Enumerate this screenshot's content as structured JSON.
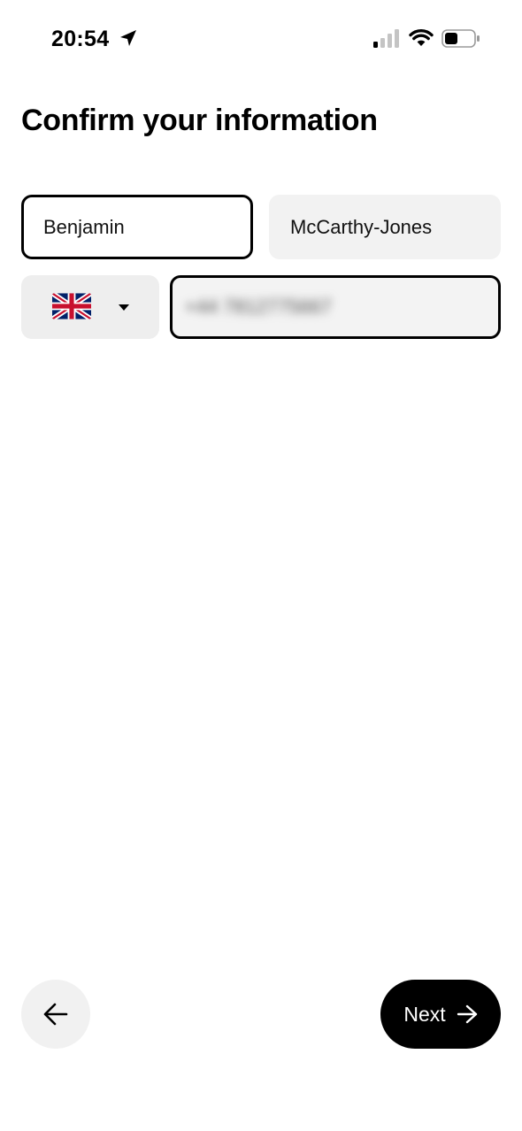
{
  "status_bar": {
    "time": "20:54",
    "location_icon": "location-arrow-icon",
    "signal_icon": "cellular-signal-icon",
    "wifi_icon": "wifi-icon",
    "battery_icon": "battery-icon"
  },
  "title": "Confirm your information",
  "form": {
    "first_name": "Benjamin",
    "last_name": "McCarthy-Jones",
    "country_flag": "uk-flag-icon",
    "phone_value": "+44 7812775667"
  },
  "footer": {
    "back_icon": "arrow-left-icon",
    "next_label": "Next",
    "next_icon": "arrow-right-icon"
  },
  "colors": {
    "background": "#ffffff",
    "primary": "#000000",
    "field_fill": "#f2f2f2",
    "button_text": "#ffffff"
  }
}
